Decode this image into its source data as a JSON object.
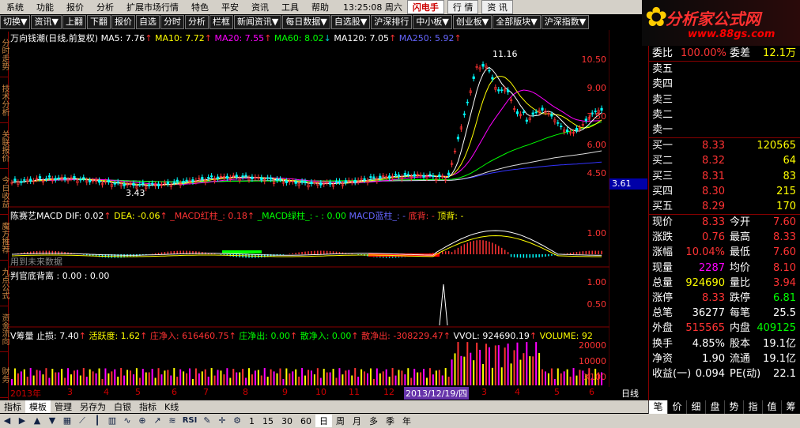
{
  "menu": {
    "items": [
      "系统",
      "功能",
      "报价",
      "分析",
      "扩展市场行情",
      "特色",
      "平安",
      "资讯",
      "工具",
      "帮助"
    ],
    "time": "13:25:08 周六",
    "flash_label": "闪电手",
    "quote_label": "行  情",
    "info_label": "资  讯"
  },
  "toolbar": {
    "items": [
      "切换▼",
      "资讯▼",
      "上翻",
      "下翻",
      "报价",
      "自选",
      "分时",
      "分析",
      "栏框",
      "新闻资讯▼",
      "每日数据▼",
      "自选股▼",
      "沪深排行",
      "中小板▼",
      "创业板▼",
      "全部版块▼",
      "沪深指数▼"
    ]
  },
  "logo": {
    "title": "分析家公式网",
    "url": "www.88gs.com"
  },
  "left_tabs": [
    "分时走势",
    "技术分析",
    "关联报价",
    "今日收益",
    "魔方推荐",
    "九点公式",
    "资金流向",
    "财务"
  ],
  "main_chart": {
    "title": "万向钱潮(日线,前复权)",
    "ma": [
      {
        "label": "MA5: 7.76",
        "color": "#ffffff"
      },
      {
        "label": "MA10: 7.72",
        "color": "#ffff00"
      },
      {
        "label": "MA20: 7.55",
        "color": "#ff00ff"
      },
      {
        "label": "MA60: 8.02",
        "color": "#00ff00"
      },
      {
        "label": "MA120: 7.05",
        "color": "#ffffff"
      },
      {
        "label": "MA250: 5.92",
        "color": "#3333ff"
      }
    ],
    "high_label": "11.16",
    "low_label": "3.43",
    "price_badge": "3.61",
    "y_ticks": [
      "10.50",
      "9.00",
      "7.50",
      "6.00",
      "4.50"
    ]
  },
  "macd_panel": {
    "title": "陈赛艺MACD",
    "items": [
      {
        "label": "DIF: 0.02",
        "color": "#ffffff"
      },
      {
        "label": "DEA: -0.06",
        "color": "#ffff00"
      },
      {
        "label": "_MACD红柱_: 0.18",
        "color": "#ff3333"
      },
      {
        "label": "_MACD绿柱_: - : 0.00",
        "color": "#00ff00"
      },
      {
        "label": "MACD蓝柱_: -",
        "color": "#6666ff"
      },
      {
        "label": "底背: -",
        "color": "#ff3333"
      },
      {
        "label": "顶背: -",
        "color": "#ffff00"
      }
    ],
    "note": "用到未来数据",
    "y_ticks": [
      "1.00"
    ]
  },
  "judge_panel": {
    "title": "判官底背离 : 0.00 : 0.00",
    "y_ticks": [
      "1.00",
      "0.50"
    ]
  },
  "volume_panel": {
    "title": "V筹量",
    "items": [
      {
        "label": "止损: 7.40",
        "color": "#ffffff"
      },
      {
        "label": "活跃度: 1.62",
        "color": "#ffff00"
      },
      {
        "label": "庄净入: 616460.75",
        "color": "#ff3333"
      },
      {
        "label": "庄净出: 0.00",
        "color": "#00ff00"
      },
      {
        "label": "散净入: 0.00",
        "color": "#00ff00"
      },
      {
        "label": "散净出: -308229.47",
        "color": "#ff3333"
      },
      {
        "label": "VVOL: 924690.19",
        "color": "#ffffff"
      },
      {
        "label": "VOLUME: 92",
        "color": "#ffff00"
      }
    ],
    "y_ticks": [
      "20000",
      "10000"
    ],
    "unit": "X100"
  },
  "date_axis": {
    "labels": [
      "2013年",
      "3",
      "4",
      "5",
      "6",
      "7",
      "8",
      "9",
      "10",
      "11",
      "12",
      "2013/12/19/四",
      "3",
      "4",
      "5",
      "6"
    ],
    "period": "日线"
  },
  "right_panel": {
    "weibi_label": "委比",
    "weibi": "100.00%",
    "weicha_label": "委差",
    "weicha": "12.1万",
    "sells": [
      {
        "label": "卖五",
        "price": "",
        "vol": ""
      },
      {
        "label": "卖四",
        "price": "",
        "vol": ""
      },
      {
        "label": "卖三",
        "price": "",
        "vol": ""
      },
      {
        "label": "卖二",
        "price": "",
        "vol": ""
      },
      {
        "label": "卖一",
        "price": "",
        "vol": ""
      }
    ],
    "buys": [
      {
        "label": "买一",
        "price": "8.33",
        "vol": "120565"
      },
      {
        "label": "买二",
        "price": "8.32",
        "vol": "64"
      },
      {
        "label": "买三",
        "price": "8.31",
        "vol": "83"
      },
      {
        "label": "买四",
        "price": "8.30",
        "vol": "215"
      },
      {
        "label": "买五",
        "price": "8.29",
        "vol": "170"
      }
    ],
    "stats": [
      {
        "l1": "现价",
        "v1": "8.33",
        "c1": "red",
        "l2": "今开",
        "v2": "7.60",
        "c2": "red"
      },
      {
        "l1": "涨跌",
        "v1": "0.76",
        "c1": "red",
        "l2": "最高",
        "v2": "8.33",
        "c2": "red"
      },
      {
        "l1": "涨幅",
        "v1": "10.04%",
        "c1": "red",
        "l2": "最低",
        "v2": "7.60",
        "c2": "red"
      },
      {
        "l1": "现量",
        "v1": "2287",
        "c1": "mag",
        "l2": "均价",
        "v2": "8.10",
        "c2": "red"
      },
      {
        "l1": "总量",
        "v1": "924690",
        "c1": "yel",
        "l2": "量比",
        "v2": "3.94",
        "c2": "red"
      },
      {
        "l1": "涨停",
        "v1": "8.33",
        "c1": "red",
        "l2": "跌停",
        "v2": "6.81",
        "c2": "grn"
      },
      {
        "l1": "总笔",
        "v1": "36277",
        "c1": "wht",
        "l2": "每笔",
        "v2": "25.5",
        "c2": "wht"
      },
      {
        "l1": "外盘",
        "v1": "515565",
        "c1": "red",
        "l2": "内盘",
        "v2": "409125",
        "c2": "grn"
      },
      {
        "l1": "换手",
        "v1": "4.85%",
        "c1": "wht",
        "l2": "股本",
        "v2": "19.1亿",
        "c2": "wht"
      },
      {
        "l1": "净资",
        "v1": "1.90",
        "c1": "wht",
        "l2": "流通",
        "v2": "19.1亿",
        "c2": "wht"
      },
      {
        "l1": "收益(一)",
        "v1": "0.094",
        "c1": "wht",
        "l2": "PE(动)",
        "v2": "22.1",
        "c2": "wht"
      }
    ]
  },
  "bottom_tabs": [
    "指标",
    "模板",
    "管理",
    "另存为",
    "白银",
    "指标",
    "K线"
  ],
  "bottom_bar": {
    "periods": [
      "1",
      "15",
      "30",
      "60",
      "日",
      "周",
      "月",
      "多",
      "季",
      "年"
    ]
  },
  "right_tabs": [
    "笔",
    "价",
    "细",
    "盘",
    "势",
    "指",
    "值",
    "筹"
  ]
}
